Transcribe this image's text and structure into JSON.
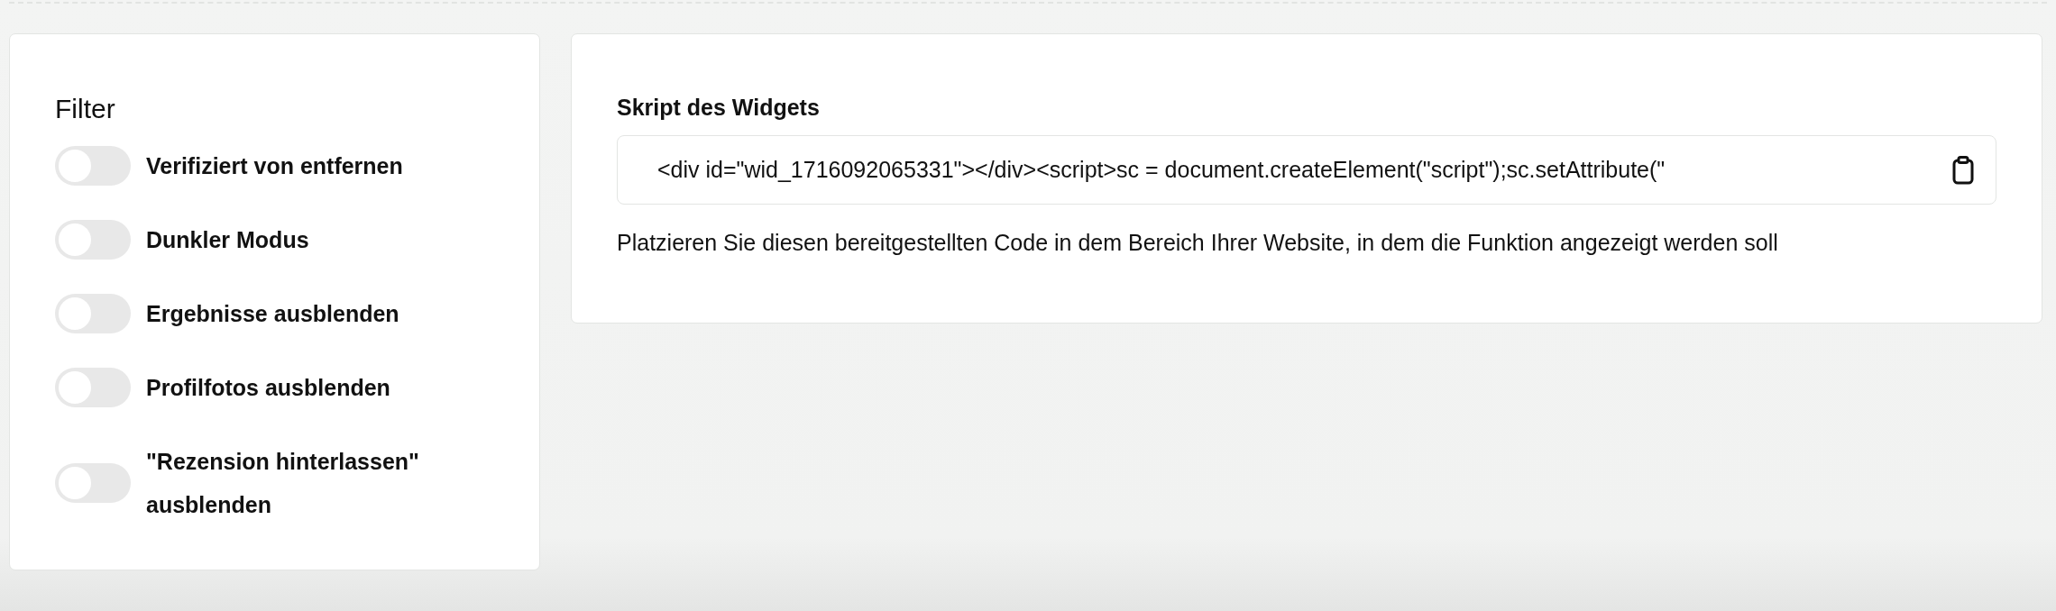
{
  "filter": {
    "title": "Filter",
    "toggles": [
      {
        "label": "Verifiziert von entfernen",
        "on": false
      },
      {
        "label": "Dunkler Modus",
        "on": false
      },
      {
        "label": "Ergebnisse ausblenden",
        "on": false
      },
      {
        "label": "Profilfotos ausblenden",
        "on": false
      },
      {
        "label": "\"Rezension hinterlassen\" ausblenden",
        "on": false
      }
    ]
  },
  "widget": {
    "title": "Skript des Widgets",
    "code": "<div id=\"wid_1716092065331\"></div><script>sc = document.createElement(\"script\");sc.setAttribute(\"",
    "hint": "Platzieren Sie diesen bereitgestellten Code in dem Bereich Ihrer Website, in dem die Funktion angezeigt werden soll"
  }
}
